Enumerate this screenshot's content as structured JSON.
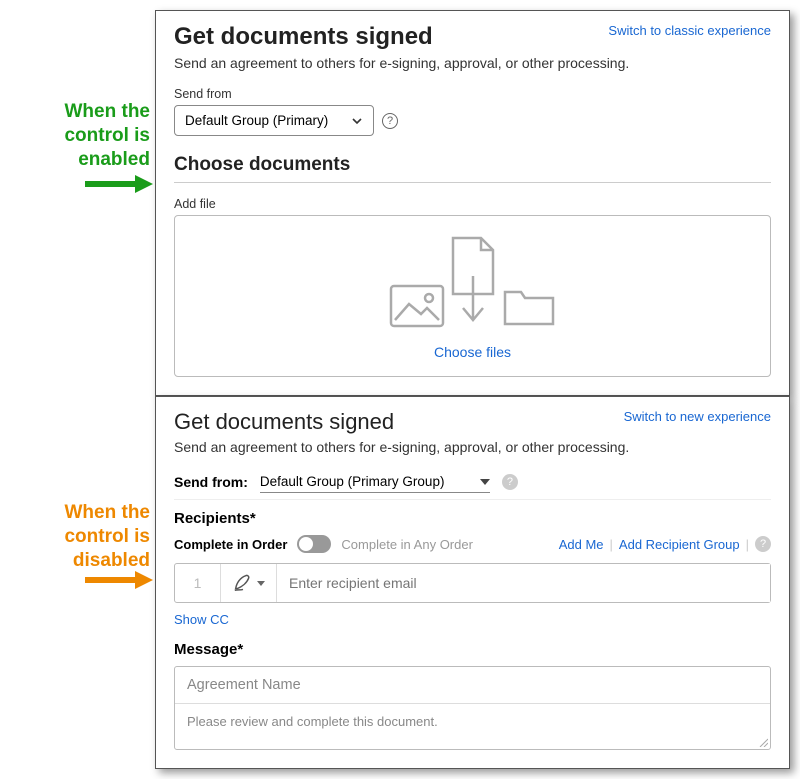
{
  "callouts": {
    "enabled": "When the control is enabled",
    "disabled": "When the control is disabled"
  },
  "modern": {
    "switch_link": "Switch to classic experience",
    "title": "Get documents signed",
    "subtitle": "Send an agreement to others for e-signing, approval, or other processing.",
    "send_from_label": "Send from",
    "send_from_value": "Default Group (Primary)",
    "choose_docs": "Choose documents",
    "add_file_label": "Add file",
    "choose_files": "Choose files"
  },
  "classic": {
    "switch_link": "Switch to new experience",
    "title": "Get documents signed",
    "subtitle": "Send an agreement to others for e-signing, approval, or other processing.",
    "send_from_label": "Send from:",
    "send_from_value": "Default Group (Primary Group)",
    "recipients_label": "Recipients*",
    "complete_in_order": "Complete in Order",
    "complete_any_order": "Complete in Any Order",
    "add_me": "Add Me",
    "add_recipient_group": "Add Recipient Group",
    "recipient_index": "1",
    "recipient_placeholder": "Enter recipient email",
    "show_cc": "Show CC",
    "message_label": "Message*",
    "agreement_name_placeholder": "Agreement Name",
    "message_body_placeholder": "Please review and complete this document."
  }
}
